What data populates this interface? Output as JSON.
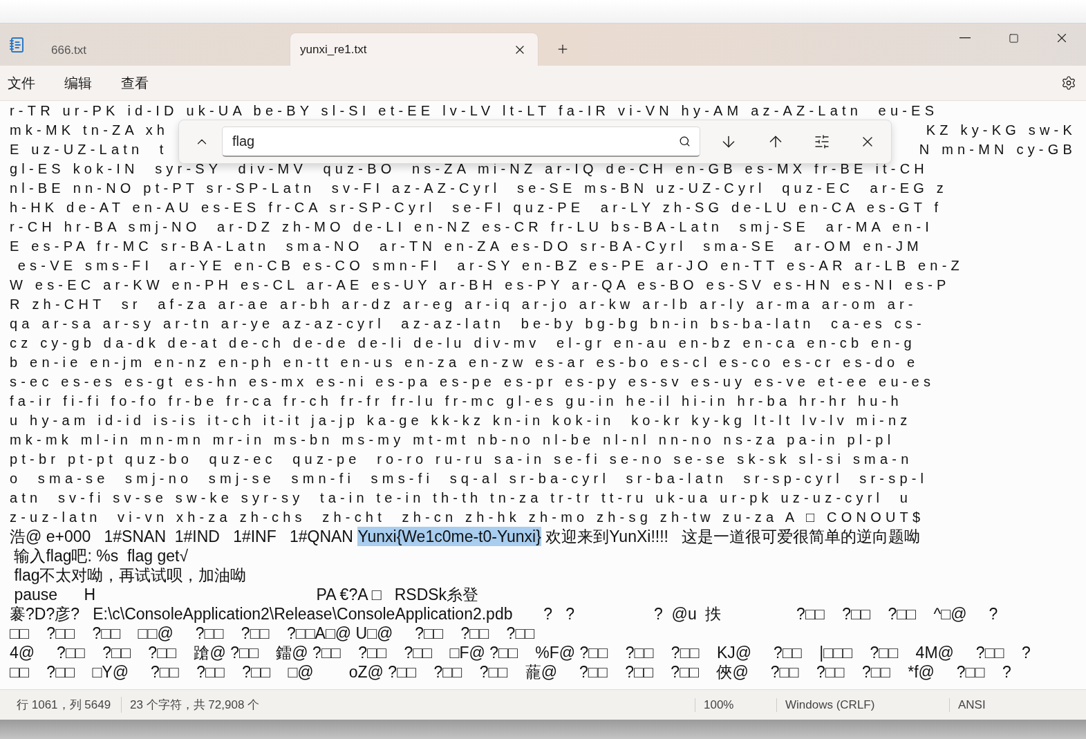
{
  "tabs": [
    {
      "label": "666.txt",
      "selected": false
    },
    {
      "label": "yunxi_re1.txt",
      "selected": true
    }
  ],
  "menu": [
    "文件",
    "编辑",
    "查看"
  ],
  "find": {
    "value": "flag"
  },
  "lines": [
    {
      "kind": "spaced",
      "text": "r-TR ur-PK id-ID uk-UA be-BY sl-SI et-EE lv-LV lt-LT fa-IR vi-VN hy-AM az-AZ-Latn  eu-ES"
    },
    {
      "kind": "covered",
      "left": "mk-MK tn-ZA xh",
      "right": "KZ ky-KG sw-K"
    },
    {
      "kind": "covered",
      "left": "E uz-UZ-Latn  t",
      "right": "N mn-MN cy-GB"
    },
    {
      "kind": "spaced",
      "text": "gl-ES kok-IN  syr-SY  div-MV  quz-BO  ns-ZA mi-NZ ar-IQ de-CH en-GB es-MX fr-BE it-CH"
    },
    {
      "kind": "spaced",
      "text": "nl-BE nn-NO pt-PT sr-SP-Latn  sv-FI az-AZ-Cyrl  se-SE ms-BN uz-UZ-Cyrl  quz-EC  ar-EG z"
    },
    {
      "kind": "spaced",
      "text": "h-HK de-AT en-AU es-ES fr-CA sr-SP-Cyrl  se-FI quz-PE  ar-LY zh-SG de-LU en-CA es-GT f"
    },
    {
      "kind": "spaced",
      "text": "r-CH hr-BA smj-NO  ar-DZ zh-MO de-LI en-NZ es-CR fr-LU bs-BA-Latn  smj-SE  ar-MA en-I"
    },
    {
      "kind": "spaced",
      "text": "E es-PA fr-MC sr-BA-Latn  sma-NO  ar-TN en-ZA es-DO sr-BA-Cyrl  sma-SE  ar-OM en-JM"
    },
    {
      "kind": "spaced",
      "text": " es-VE sms-FI  ar-YE en-CB es-CO smn-FI  ar-SY en-BZ es-PE ar-JO en-TT es-AR ar-LB en-Z"
    },
    {
      "kind": "spaced",
      "text": "W es-EC ar-KW en-PH es-CL ar-AE es-UY ar-BH es-PY ar-QA es-BO es-SV es-HN es-NI es-P"
    },
    {
      "kind": "spaced",
      "text": "R zh-CHT  sr  af-za ar-ae ar-bh ar-dz ar-eg ar-iq ar-jo ar-kw ar-lb ar-ly ar-ma ar-om ar-"
    },
    {
      "kind": "spaced",
      "text": "qa ar-sa ar-sy ar-tn ar-ye az-az-cyrl  az-az-latn  be-by bg-bg bn-in bs-ba-latn  ca-es cs-"
    },
    {
      "kind": "spaced",
      "text": "cz cy-gb da-dk de-at de-ch de-de de-li de-lu div-mv  el-gr en-au en-bz en-ca en-cb en-g"
    },
    {
      "kind": "spaced",
      "text": "b en-ie en-jm en-nz en-ph en-tt en-us en-za en-zw es-ar es-bo es-cl es-co es-cr es-do e"
    },
    {
      "kind": "spaced",
      "text": "s-ec es-es es-gt es-hn es-mx es-ni es-pa es-pe es-pr es-py es-sv es-uy es-ve et-ee eu-es"
    },
    {
      "kind": "spaced",
      "text": "fa-ir fi-fi fo-fo fr-be fr-ca fr-ch fr-fr fr-lu fr-mc gl-es gu-in he-il hi-in hr-ba hr-hr hu-h"
    },
    {
      "kind": "spaced",
      "text": "u hy-am id-id is-is it-ch it-it ja-jp ka-ge kk-kz kn-in kok-in  ko-kr ky-kg lt-lt lv-lv mi-nz"
    },
    {
      "kind": "spaced",
      "text": "mk-mk ml-in mn-mn mr-in ms-bn ms-my mt-mt nb-no nl-be nl-nl nn-no ns-za pa-in pl-pl"
    },
    {
      "kind": "spaced",
      "text": "pt-br pt-pt quz-bo  quz-ec  quz-pe  ro-ro ru-ru sa-in se-fi se-no se-se sk-sk sl-si sma-n"
    },
    {
      "kind": "spaced",
      "text": "o  sma-se  smj-no  smj-se  smn-fi  sms-fi  sq-al sr-ba-cyrl  sr-ba-latn  sr-sp-cyrl  sr-sp-l"
    },
    {
      "kind": "spaced",
      "text": "atn  sv-fi sv-se sw-ke syr-sy  ta-in te-in th-th tn-za tr-tr tt-ru uk-ua ur-pk uz-uz-cyrl  u"
    },
    {
      "kind": "spaced",
      "text": "z-uz-latn  vi-vn xh-za zh-chs  zh-cht  zh-cn zh-hk zh-mo zh-sg zh-tw zu-za A □ CONOUT$"
    },
    {
      "kind": "match",
      "before": "浩@ e+000   1#SNAN  1#IND   1#INF   1#QNAN ",
      "match": "Yunxi{We1c0me-t0-Yunxi}",
      "after": " 欢迎来到YunXi!!!!   这是一道很可爱很简单的逆向题呦"
    },
    {
      "kind": "plain",
      "text": " 输入flag吧: %s  flag get√"
    },
    {
      "kind": "plain",
      "text": " flag不太对呦，再试试呗，加油呦"
    },
    {
      "kind": "plain",
      "text": " pause      H                                                  PA €?A □   RSDSk糸登"
    },
    {
      "kind": "plain",
      "text": "褰?D?彦?   E:\\c\\ConsoleApplication2\\Release\\ConsoleApplication2.pdb       ?   ?                  ?  @u  抶                 ?□□    ?□□    ?□□    ^□@     ?"
    },
    {
      "kind": "plain",
      "text": "□□    ?□□    ?□□    □□@     ?□□    ?□□    ?□□A□@ U□@     ?□□    ?□□    ?□□"
    },
    {
      "kind": "plain",
      "text": "4@     ?□□    ?□□    ?□□    蹌@ ?□□    鐳@ ?□□    ?□□    ?□□    □F@ ?□□    %F@ ?□□    ?□□    ?□□    KJ@     ?□□    |□□□    ?□□    4M@     ?□□    ?"
    },
    {
      "kind": "plain",
      "text": "□□    ?□□    □Y@     ?□□    ?□□    ?□□    □@        oZ@ ?□□    ?□□    ?□□    蘢@     ?□□    ?□□    ?□□    俠@     ?□□    ?□□    ?□□    *f@     ?□□    ?"
    }
  ],
  "status": [
    "行 1061，列 5649",
    "23 个字符，共 72,908 个",
    "100%",
    "Windows (CRLF)",
    "ANSI"
  ]
}
